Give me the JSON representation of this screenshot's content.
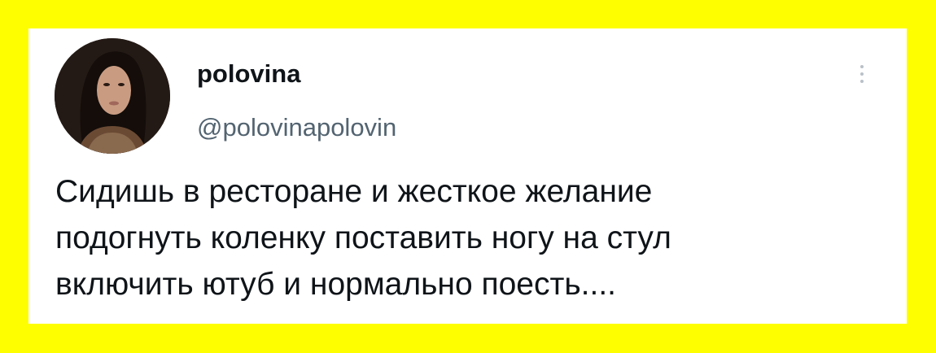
{
  "colors": {
    "page_background": "#fffe00",
    "card_background": "#ffffff",
    "name_color": "#0f1419",
    "handle_color": "#536471"
  },
  "tweet": {
    "author": {
      "display_name": "polovina",
      "handle": "@polovinapolovin",
      "avatar_icon": "profile-photo"
    },
    "more_icon": "more-vertical-icon",
    "text_lines": [
      "Сидишь в ресторане и жесткое желание",
      "подогнуть коленку поставить ногу на стул",
      "включить ютуб и нормально поесть...."
    ]
  }
}
